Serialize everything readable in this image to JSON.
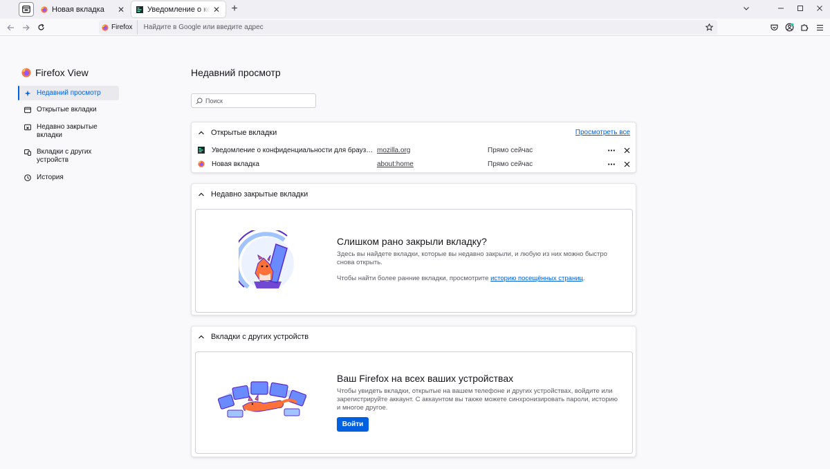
{
  "tabs": [
    {
      "label": "Новая вкладка",
      "selected": false,
      "favicon": "firefox-icon"
    },
    {
      "label": "Уведомление о конфиденциальности для браузера F",
      "selected": true,
      "favicon": "mozilla-icon"
    }
  ],
  "urlbar": {
    "identity_label": "Firefox",
    "placeholder": "Найдите в Google или введите адрес"
  },
  "sidebar": {
    "title": "Firefox View",
    "items": [
      {
        "label": "Недавний просмотр",
        "icon": "sparkle-icon",
        "active": true
      },
      {
        "label": "Открытые вкладки",
        "icon": "tabs-icon",
        "active": false
      },
      {
        "label": "Недавно закрытые вкладки",
        "icon": "closed-tab-icon",
        "active": false
      },
      {
        "label": "Вкладки с других устройств",
        "icon": "devices-icon",
        "active": false
      },
      {
        "label": "История",
        "icon": "history-icon",
        "active": false
      }
    ]
  },
  "main": {
    "title": "Недавний просмотр",
    "search_placeholder": "Поиск",
    "open_tabs": {
      "heading": "Открытые вкладки",
      "view_all": "Просмотреть все",
      "rows": [
        {
          "title": "Уведомление о конфиденциальности для браузера Firefox",
          "url": "mozilla.org",
          "time": "Прямо сейчас",
          "favicon": "mozilla-icon"
        },
        {
          "title": "Новая вкладка",
          "url": "about:home",
          "time": "Прямо сейчас",
          "favicon": "firefox-icon"
        }
      ]
    },
    "recently_closed": {
      "heading": "Недавно закрытые вкладки",
      "empty_title": "Слишком рано закрыли вкладку?",
      "empty_desc": "Здесь вы найдете вкладки, которые вы недавно закрыли, и любую из них можно быстро снова открыть.",
      "history_prefix": "Чтобы найти более ранние вкладки, просмотрите ",
      "history_link": "историю посещённых страниц",
      "history_suffix": "."
    },
    "other_devices": {
      "heading": "Вкладки с других устройств",
      "empty_title": "Ваш Firefox на всех ваших устройствах",
      "empty_desc": "Чтобы увидеть вкладки, открытые на вашем телефоне и других устройствах, войдите или зарегистрируйте аккаунт. С аккаунтом вы также можете синхронизировать пароли, историю и многое другое.",
      "signin_label": "Войти"
    }
  },
  "colors": {
    "accent": "#0061e0",
    "firefox_orange": "#ff7139",
    "illustration_blue": "#592acb"
  }
}
